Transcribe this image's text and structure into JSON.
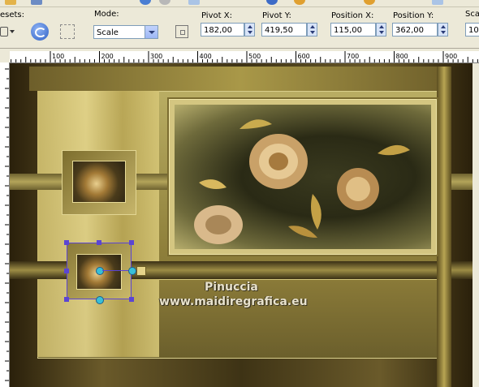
{
  "options": {
    "presets_label": "esets:",
    "mode_label": "Mode:",
    "mode_value": "Scale",
    "pivot_x_label": "Pivot X:",
    "pivot_x_value": "182,00",
    "pivot_y_label": "Pivot Y:",
    "pivot_y_value": "419,50",
    "position_x_label": "Position X:",
    "position_x_value": "115,00",
    "position_y_label": "Position Y:",
    "position_y_value": "362,00",
    "scale_label": "Sca",
    "scale_value": "10"
  },
  "ruler": {
    "h_ticks": [
      "100",
      "200",
      "300",
      "400",
      "500",
      "600",
      "700",
      "800",
      "900"
    ]
  },
  "canvas": {
    "watermark_line1": "Pinuccia",
    "watermark_line2": "www.maidiregrafica.eu"
  },
  "colors": {
    "accent_gold": "#c9b86a",
    "dark_brown": "#1a1306",
    "olive": "#8e7f3a"
  }
}
